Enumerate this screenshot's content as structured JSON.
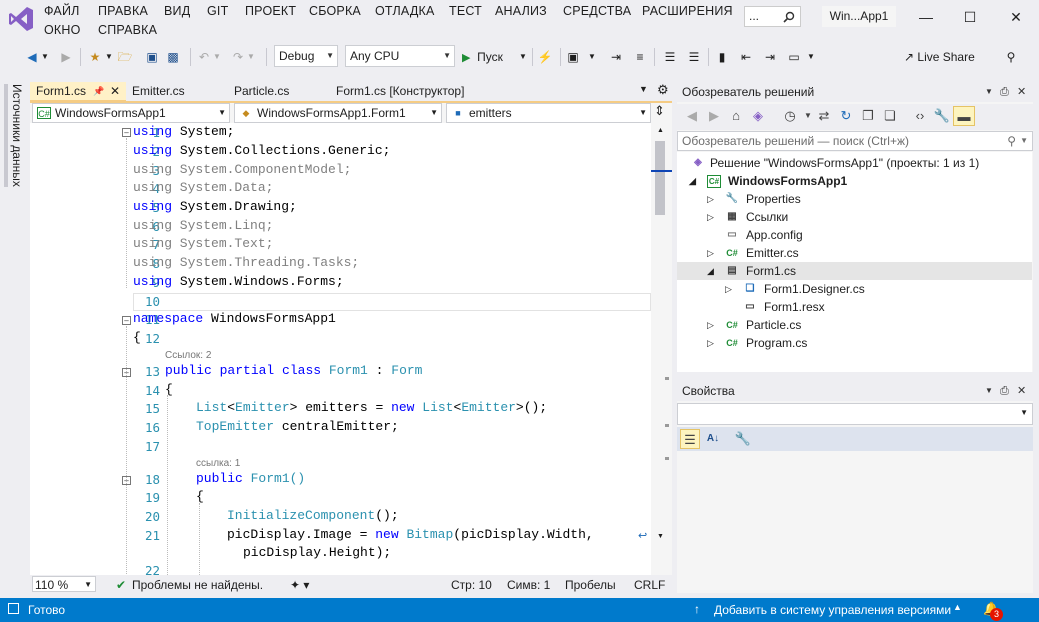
{
  "menu": {
    "items": [
      "ФАЙЛ",
      "ПРАВКА",
      "ВИД",
      "GIT",
      "ПРОЕКТ",
      "СБОРКА",
      "ОТЛАДКА",
      "ТЕСТ",
      "АНАЛИЗ",
      "СРЕДСТВА",
      "РАСШИРЕНИЯ",
      "ОКНО",
      "СПРАВКА"
    ],
    "search_placeholder": "...",
    "window_title": "Win...App1"
  },
  "toolbar": {
    "config": "Debug",
    "platform": "Any CPU",
    "start_label": "Пуск",
    "live_share": "Live Share"
  },
  "left_rail": {
    "label": "Источники данных"
  },
  "editor_tabs": [
    {
      "label": "Form1.cs",
      "active": true
    },
    {
      "label": "Emitter.cs",
      "active": false
    },
    {
      "label": "Particle.cs",
      "active": false
    },
    {
      "label": "Form1.cs [Конструктор]",
      "active": false
    }
  ],
  "navbar": {
    "project": "WindowsFormsApp1",
    "class": "WindowsFormsApp1.Form1",
    "member": "emitters"
  },
  "code": {
    "line_numbers": [
      "1",
      "2",
      "3",
      "4",
      "5",
      "6",
      "7",
      "8",
      "9",
      "10",
      "11",
      "12",
      "13",
      "14",
      "15",
      "16",
      "17",
      "18",
      "19",
      "20",
      "21",
      "22"
    ],
    "lens_refs2": "Ссылок: 2",
    "lens_refs1": "ссылка: 1",
    "l1": [
      "using",
      " System;"
    ],
    "l2": [
      "using",
      " System.Collections.Generic;"
    ],
    "l3": "using System.ComponentModel;",
    "l4": "using System.Data;",
    "l5": [
      "using",
      " System.Drawing;"
    ],
    "l6": "using System.Linq;",
    "l7": "using System.Text;",
    "l8": "using System.Threading.Tasks;",
    "l9": [
      "using",
      " System.Windows.Forms;"
    ],
    "l11": [
      "namespace",
      " WindowsFormsApp1"
    ],
    "l12": "{",
    "l13": [
      "public",
      " partial",
      " class",
      " Form1",
      " : ",
      "Form"
    ],
    "l14": "{",
    "l15": [
      "List",
      "<",
      "Emitter",
      "> emitters = ",
      "new",
      " ",
      "List",
      "<",
      "Emitter",
      ">();"
    ],
    "l16": [
      "TopEmitter",
      " centralEmitter;"
    ],
    "l18": [
      "public",
      " Form1()"
    ],
    "l19": "{",
    "l20": [
      "InitializeComponent",
      "();"
    ],
    "l21": [
      "picDisplay.Image = ",
      "new",
      " ",
      "Bitmap",
      "(picDisplay.Width,"
    ],
    "l21b": "picDisplay.Height);"
  },
  "editor_status": {
    "zoom": "110 %",
    "problems": "Проблемы не найдены.",
    "line": "Стр: 10",
    "col": "Симв: 1",
    "spaces": "Пробелы",
    "eol": "CRLF"
  },
  "solution_explorer": {
    "title": "Обозреватель решений",
    "search_placeholder": "Обозреватель решений — поиск (Ctrl+ж)",
    "items": [
      {
        "label": "Решение \"WindowsFormsApp1\" (проекты: 1 из 1)",
        "icon": "solution-icon"
      },
      {
        "label": "WindowsFormsApp1",
        "icon": "csharp-project-icon"
      },
      {
        "label": "Properties",
        "icon": "wrench-icon"
      },
      {
        "label": "Ссылки",
        "icon": "references-icon"
      },
      {
        "label": "App.config",
        "icon": "config-file-icon"
      },
      {
        "label": "Emitter.cs",
        "icon": "csharp-file-icon"
      },
      {
        "label": "Form1.cs",
        "icon": "form-icon"
      },
      {
        "label": "Form1.Designer.cs",
        "icon": "csharp-file-icon"
      },
      {
        "label": "Form1.resx",
        "icon": "resx-icon"
      },
      {
        "label": "Particle.cs",
        "icon": "csharp-file-icon"
      },
      {
        "label": "Program.cs",
        "icon": "csharp-file-icon"
      }
    ]
  },
  "properties": {
    "title": "Свойства"
  },
  "statusbar": {
    "ready": "Готово",
    "source_control": "Добавить в систему управления версиями",
    "notifications": "3"
  },
  "colors": {
    "accent": "#007acc",
    "tab_active": "#fff1c7",
    "keyword": "#0000ff",
    "type": "#2b91af"
  }
}
